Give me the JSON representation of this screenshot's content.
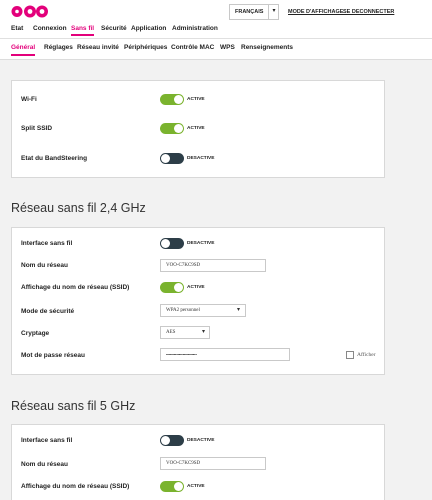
{
  "header": {
    "logo_colors": [
      "#e3007b",
      "#e3007b",
      "#e3007b"
    ],
    "language": "FRANÇAIS",
    "mode_link": "MODE D'AFFICHAGE",
    "logout_link": "SE DECONNECTER"
  },
  "main_nav": [
    "Etat",
    "Connexion",
    "Sans fil",
    "Sécurité",
    "Application",
    "Administration"
  ],
  "main_nav_active": "Sans fil",
  "sub_nav": [
    "Général",
    "Réglages",
    "Réseau invité",
    "Périphériques",
    "Contrôle MAC",
    "WPS",
    "Renseignements"
  ],
  "sub_nav_active": "Général",
  "general": {
    "rows": [
      {
        "label": "Wi-Fi",
        "state": "ACTIVE",
        "on": true
      },
      {
        "label": "Split SSID",
        "state": "ACTIVE",
        "on": true
      },
      {
        "label": "Etat du BandSteering",
        "state": "DESACTIVE",
        "on": false
      }
    ]
  },
  "wifi24": {
    "title": "Réseau sans fil 2,4 GHz",
    "interface_label": "Interface sans fil",
    "interface_state": "DESACTIVE",
    "ssid_label": "Nom du réseau",
    "ssid_value": "VOO-C7KC9SD",
    "broadcast_label": "Affichage du nom de réseau (SSID)",
    "broadcast_state": "ACTIVE",
    "security_label": "Mode de sécurité",
    "security_value": "WPA2 personnel",
    "encryption_label": "Cryptage",
    "encryption_value": "AES",
    "password_label": "Mot de passe réseau",
    "password_value": "••••••••••••••••••••••••",
    "show_label": "Afficher"
  },
  "wifi5": {
    "title": "Réseau sans fil 5 GHz",
    "interface_label": "Interface sans fil",
    "interface_state": "DESACTIVE",
    "ssid_label": "Nom du réseau",
    "ssid_value": "VOO-C7KC9SD",
    "broadcast_label": "Affichage du nom de réseau (SSID)",
    "broadcast_state": "ACTIVE"
  },
  "colors": {
    "accent": "#e3007b",
    "toggle_on": "#7ab32e",
    "toggle_off": "#2d3e48"
  }
}
